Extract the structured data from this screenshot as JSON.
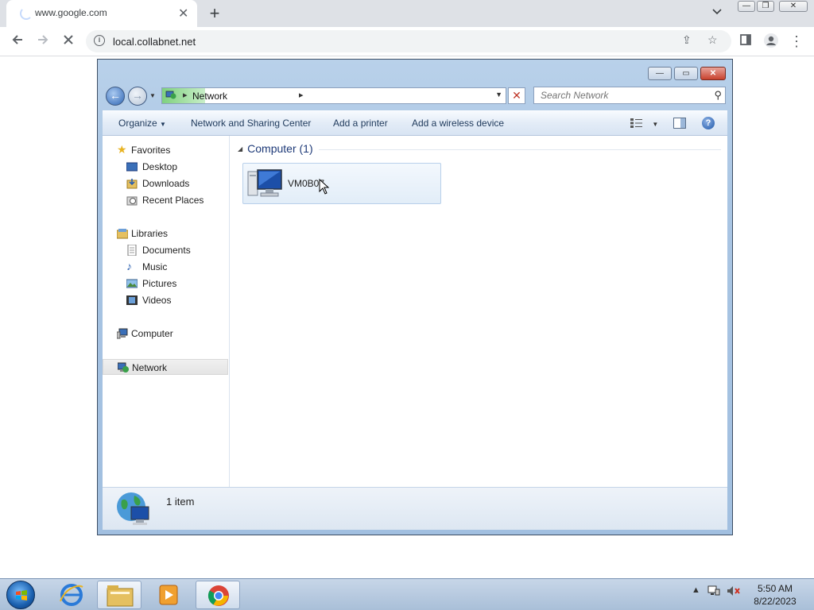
{
  "browser": {
    "tab_title": "www.google.com",
    "url": "local.collabnet.net"
  },
  "explorer": {
    "breadcrumb": "Network",
    "search_placeholder": "Search Network",
    "commands": [
      "Organize",
      "Network and Sharing Center",
      "Add a printer",
      "Add a wireless device"
    ],
    "nav": {
      "favorites": "Favorites",
      "desktop": "Desktop",
      "downloads": "Downloads",
      "recent": "Recent Places",
      "libraries": "Libraries",
      "documents": "Documents",
      "music": "Music",
      "pictures": "Pictures",
      "videos": "Videos",
      "computer": "Computer",
      "network": "Network"
    },
    "group_header": "Computer (1)",
    "items": [
      {
        "name": "VM0B07",
        "icon": "computer-icon"
      }
    ],
    "status": "1 item"
  },
  "taskbar": {
    "time": "5:50 AM",
    "date": "8/22/2023"
  },
  "colors": {
    "explorer_frame": "#a9c5e3",
    "tile_selected": "#e2edf8",
    "taskbar": "#a9bfd8"
  }
}
